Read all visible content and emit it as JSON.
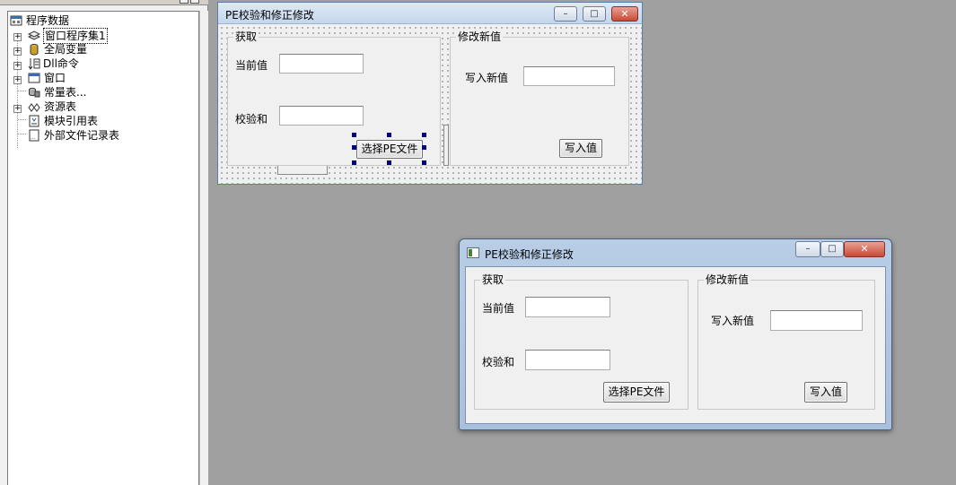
{
  "tree": {
    "root_label": "程序数据",
    "items": [
      {
        "label": "窗口程序集1",
        "icon": "assembly-icon"
      },
      {
        "label": "全局变量",
        "icon": "global-var-icon"
      },
      {
        "label": "Dll命令",
        "icon": "dll-command-icon"
      },
      {
        "label": "窗口",
        "icon": "window-icon"
      },
      {
        "label": "常量表...",
        "icon": "constant-table-icon"
      },
      {
        "label": "资源表",
        "icon": "resource-table-icon"
      },
      {
        "label": "模块引用表",
        "icon": "module-ref-icon"
      },
      {
        "label": "外部文件记录表",
        "icon": "external-file-icon"
      }
    ],
    "expanders": [
      "+",
      "+",
      "+",
      "+",
      "+"
    ]
  },
  "designer": {
    "title": "PE校验和修正修改",
    "get_group": "获取",
    "current_label": "当前值",
    "checksum_label": "校验和",
    "select_button": "选择PE文件",
    "modify_group": "修改新值",
    "write_new_label": "写入新值",
    "write_button": "写入值"
  },
  "preview": {
    "title": "PE校验和修正修改",
    "get_group": "获取",
    "current_label": "当前值",
    "checksum_label": "校验和",
    "select_button": "选择PE文件",
    "modify_group": "修改新值",
    "write_new_label": "写入新值",
    "write_button": "写入值"
  },
  "window_buttons": {
    "minimize": "–",
    "maximize": "□",
    "close": "✕"
  },
  "colors": {
    "selection_handle": "#000080",
    "close_button": "#c94a34"
  }
}
